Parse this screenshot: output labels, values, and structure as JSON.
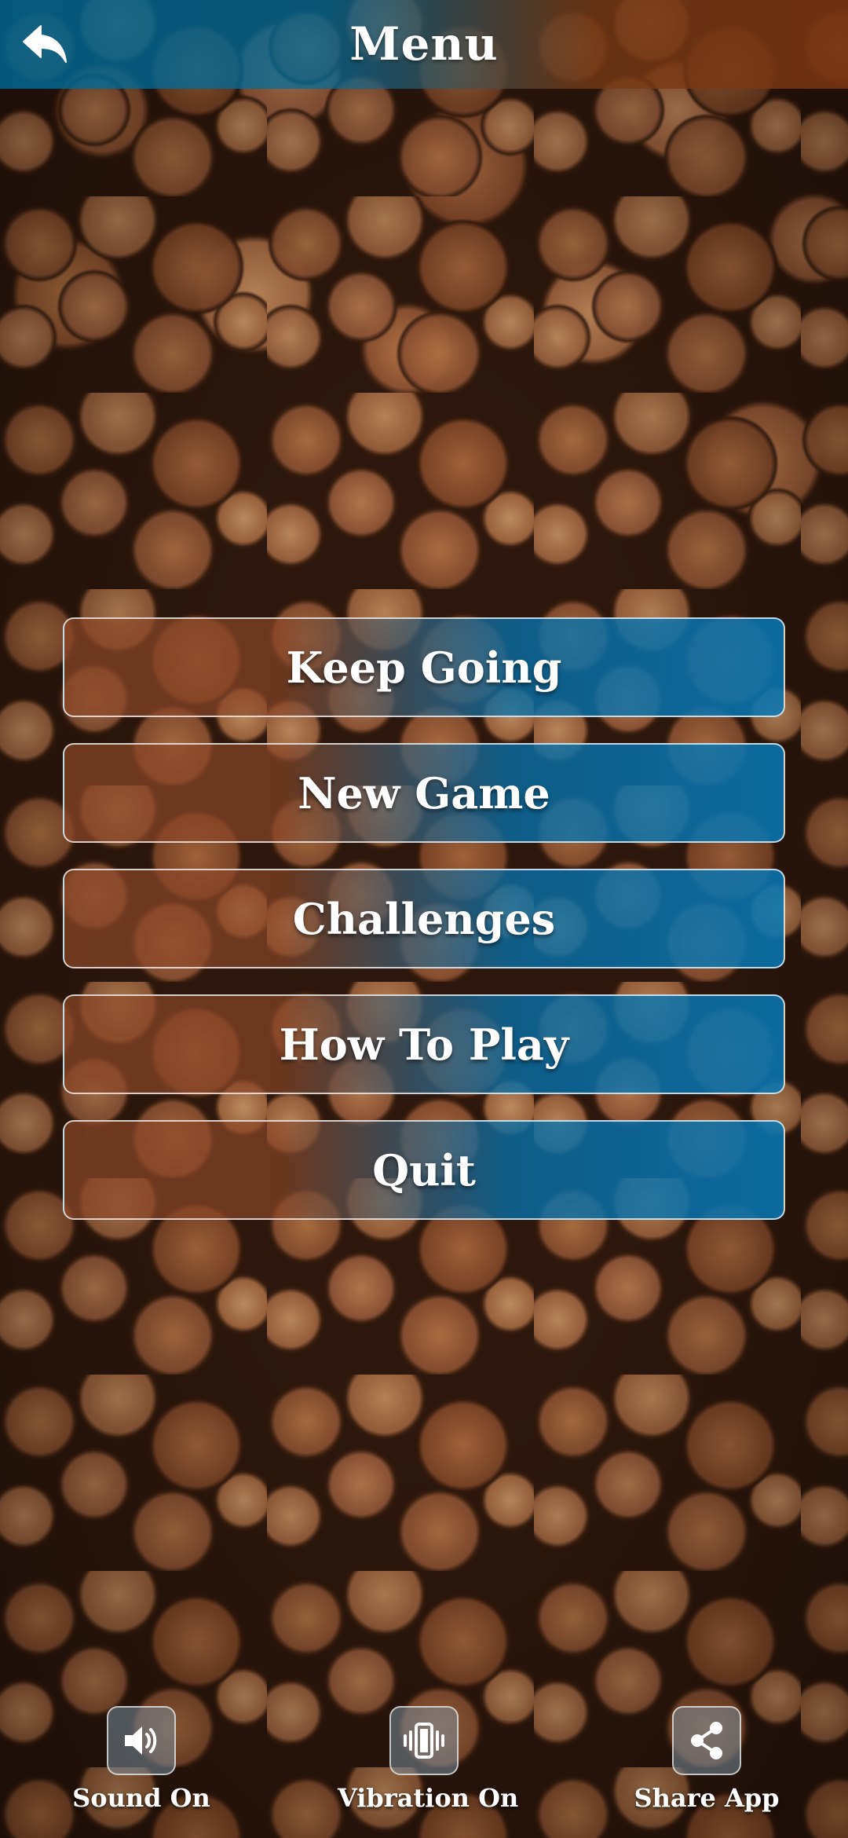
{
  "header": {
    "title": "Menu",
    "back_icon": "back-arrow-icon"
  },
  "menu": {
    "items": [
      {
        "label": "Keep Going"
      },
      {
        "label": "New Game"
      },
      {
        "label": "Challenges"
      },
      {
        "label": "How To Play"
      },
      {
        "label": "Quit"
      }
    ]
  },
  "toolbar": {
    "sound": {
      "label": "Sound On",
      "icon": "speaker-icon"
    },
    "vibration": {
      "label": "Vibration On",
      "icon": "vibration-icon"
    },
    "share": {
      "label": "Share App",
      "icon": "share-icon"
    }
  },
  "colors": {
    "accent_blue": "#0870aa",
    "accent_brown": "#8c4828",
    "text": "#ffffff"
  }
}
